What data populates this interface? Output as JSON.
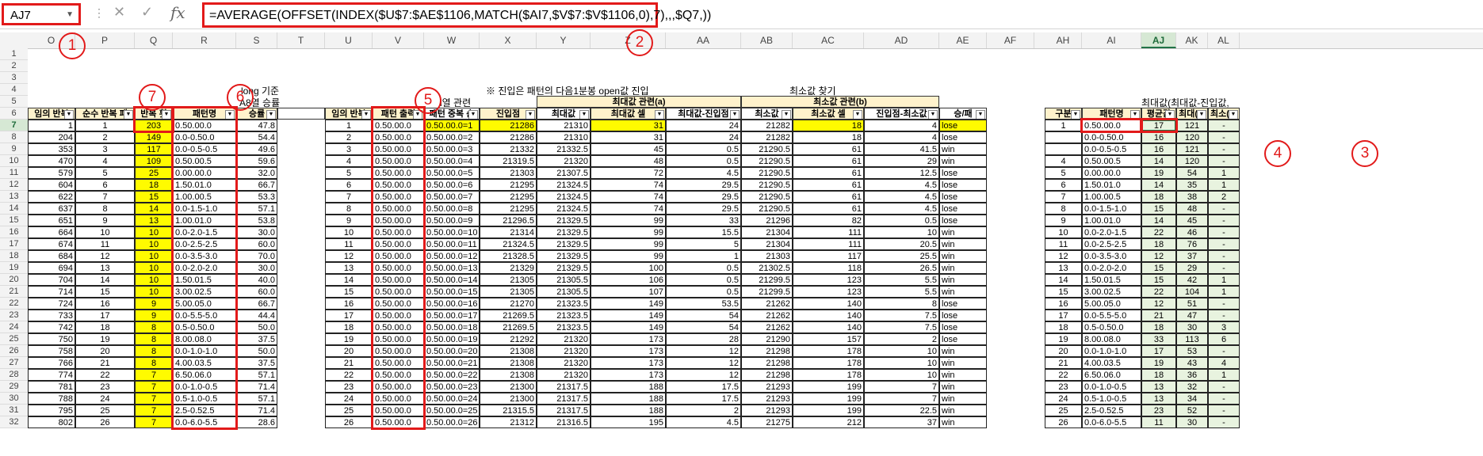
{
  "name_box": "AJ7",
  "formula": "=AVERAGE(OFFSET(INDEX($U$7:$AE$1106,MATCH($AI7,$V$7:$V$1106,0),7),,,$Q7,))",
  "callouts": [
    "1",
    "2",
    "3",
    "4",
    "5",
    "6",
    "7"
  ],
  "columns": [
    "O",
    "P",
    "Q",
    "R",
    "S",
    "T",
    "U",
    "V",
    "W",
    "X",
    "Y",
    "Z",
    "AA",
    "AB",
    "AC",
    "AD",
    "AE",
    "AF",
    "AH",
    "AI",
    "AJ",
    "AK",
    "AL"
  ],
  "row_numbers": [
    1,
    2,
    3,
    4,
    5,
    6,
    7,
    8,
    9,
    10,
    11,
    12,
    13,
    14,
    15,
    16,
    17,
    18,
    19,
    20,
    21,
    22,
    23,
    24,
    25,
    26,
    27,
    28,
    29,
    30,
    31,
    32
  ],
  "top_labels": {
    "long_label1": "long 기준",
    "long_label2": "A8열 승률",
    "note": "※ 진입은 패턴의 다음1분봉 open값 진입",
    "i_col": "i열 관련",
    "min_find": "최소값 찾기",
    "max_group": "최대값 관련(a)",
    "min_group": "최소값 관련(b)",
    "right_group": "최대값(최대값-진입값,"
  },
  "headers": {
    "O": "임의 반복",
    "P": "순수 반복 패",
    "Q": "반복 횟",
    "R": "패턴명",
    "S": "승률",
    "U": "임의 반복",
    "V": "패턴 출력",
    "W": "패턴 중복 순",
    "X": "진입점",
    "Y": "최대값",
    "Z": "최대값 셀",
    "AA": "최대값-진입점",
    "AB": "최소값",
    "AC": "최소값 셀",
    "AD": "진입점-최소값",
    "AE": "승/패",
    "AH": "구분",
    "AI": "패턴명",
    "AJ": "평균값",
    "AK": "최대(c)",
    "AL": "최소(d)"
  },
  "left_rows": [
    [
      "1",
      "1",
      "203",
      "0.50.00.0",
      "47.8"
    ],
    [
      "204",
      "2",
      "149",
      "0.0-0.50.0",
      "54.4"
    ],
    [
      "353",
      "3",
      "117",
      "0.0-0.5-0.5",
      "49.6"
    ],
    [
      "470",
      "4",
      "109",
      "0.50.00.5",
      "59.6"
    ],
    [
      "579",
      "5",
      "25",
      "0.00.00.0",
      "32.0"
    ],
    [
      "604",
      "6",
      "18",
      "1.50.01.0",
      "66.7"
    ],
    [
      "622",
      "7",
      "15",
      "1.00.00.5",
      "53.3"
    ],
    [
      "637",
      "8",
      "14",
      "0.0-1.5-1.0",
      "57.1"
    ],
    [
      "651",
      "9",
      "13",
      "1.00.01.0",
      "53.8"
    ],
    [
      "664",
      "10",
      "10",
      "0.0-2.0-1.5",
      "30.0"
    ],
    [
      "674",
      "11",
      "10",
      "0.0-2.5-2.5",
      "60.0"
    ],
    [
      "684",
      "12",
      "10",
      "0.0-3.5-3.0",
      "70.0"
    ],
    [
      "694",
      "13",
      "10",
      "0.0-2.0-2.0",
      "30.0"
    ],
    [
      "704",
      "14",
      "10",
      "1.50.01.5",
      "40.0"
    ],
    [
      "714",
      "15",
      "10",
      "3.00.02.5",
      "60.0"
    ],
    [
      "724",
      "16",
      "9",
      "5.00.05.0",
      "66.7"
    ],
    [
      "733",
      "17",
      "9",
      "0.0-5.5-5.0",
      "44.4"
    ],
    [
      "742",
      "18",
      "8",
      "0.5-0.50.0",
      "50.0"
    ],
    [
      "750",
      "19",
      "8",
      "8.00.08.0",
      "37.5"
    ],
    [
      "758",
      "20",
      "8",
      "0.0-1.0-1.0",
      "50.0"
    ],
    [
      "766",
      "21",
      "8",
      "4.00.03.5",
      "37.5"
    ],
    [
      "774",
      "22",
      "7",
      "6.50.06.0",
      "57.1"
    ],
    [
      "781",
      "23",
      "7",
      "0.0-1.0-0.5",
      "71.4"
    ],
    [
      "788",
      "24",
      "7",
      "0.5-1.0-0.5",
      "57.1"
    ],
    [
      "795",
      "25",
      "7",
      "2.5-0.52.5",
      "71.4"
    ],
    [
      "802",
      "26",
      "7",
      "0.0-6.0-5.5",
      "28.6"
    ]
  ],
  "mid_rows": [
    [
      "1",
      "0.50.00.0",
      "0.50.00.0=1",
      "21286",
      "21310",
      "31",
      "24",
      "21282",
      "18",
      "4",
      "lose"
    ],
    [
      "2",
      "0.50.00.0",
      "0.50.00.0=2",
      "21286",
      "21310",
      "31",
      "24",
      "21282",
      "18",
      "4",
      "lose"
    ],
    [
      "3",
      "0.50.00.0",
      "0.50.00.0=3",
      "21332",
      "21332.5",
      "45",
      "0.5",
      "21290.5",
      "61",
      "41.5",
      "win"
    ],
    [
      "4",
      "0.50.00.0",
      "0.50.00.0=4",
      "21319.5",
      "21320",
      "48",
      "0.5",
      "21290.5",
      "61",
      "29",
      "win"
    ],
    [
      "5",
      "0.50.00.0",
      "0.50.00.0=5",
      "21303",
      "21307.5",
      "72",
      "4.5",
      "21290.5",
      "61",
      "12.5",
      "lose"
    ],
    [
      "6",
      "0.50.00.0",
      "0.50.00.0=6",
      "21295",
      "21324.5",
      "74",
      "29.5",
      "21290.5",
      "61",
      "4.5",
      "lose"
    ],
    [
      "7",
      "0.50.00.0",
      "0.50.00.0=7",
      "21295",
      "21324.5",
      "74",
      "29.5",
      "21290.5",
      "61",
      "4.5",
      "lose"
    ],
    [
      "8",
      "0.50.00.0",
      "0.50.00.0=8",
      "21295",
      "21324.5",
      "74",
      "29.5",
      "21290.5",
      "61",
      "4.5",
      "lose"
    ],
    [
      "9",
      "0.50.00.0",
      "0.50.00.0=9",
      "21296.5",
      "21329.5",
      "99",
      "33",
      "21296",
      "82",
      "0.5",
      "lose"
    ],
    [
      "10",
      "0.50.00.0",
      "0.50.00.0=10",
      "21314",
      "21329.5",
      "99",
      "15.5",
      "21304",
      "111",
      "10",
      "win"
    ],
    [
      "11",
      "0.50.00.0",
      "0.50.00.0=11",
      "21324.5",
      "21329.5",
      "99",
      "5",
      "21304",
      "111",
      "20.5",
      "win"
    ],
    [
      "12",
      "0.50.00.0",
      "0.50.00.0=12",
      "21328.5",
      "21329.5",
      "99",
      "1",
      "21303",
      "117",
      "25.5",
      "win"
    ],
    [
      "13",
      "0.50.00.0",
      "0.50.00.0=13",
      "21329",
      "21329.5",
      "100",
      "0.5",
      "21302.5",
      "118",
      "26.5",
      "win"
    ],
    [
      "14",
      "0.50.00.0",
      "0.50.00.0=14",
      "21305",
      "21305.5",
      "106",
      "0.5",
      "21299.5",
      "123",
      "5.5",
      "win"
    ],
    [
      "15",
      "0.50.00.0",
      "0.50.00.0=15",
      "21305",
      "21305.5",
      "107",
      "0.5",
      "21299.5",
      "123",
      "5.5",
      "win"
    ],
    [
      "16",
      "0.50.00.0",
      "0.50.00.0=16",
      "21270",
      "21323.5",
      "149",
      "53.5",
      "21262",
      "140",
      "8",
      "lose"
    ],
    [
      "17",
      "0.50.00.0",
      "0.50.00.0=17",
      "21269.5",
      "21323.5",
      "149",
      "54",
      "21262",
      "140",
      "7.5",
      "lose"
    ],
    [
      "18",
      "0.50.00.0",
      "0.50.00.0=18",
      "21269.5",
      "21323.5",
      "149",
      "54",
      "21262",
      "140",
      "7.5",
      "lose"
    ],
    [
      "19",
      "0.50.00.0",
      "0.50.00.0=19",
      "21292",
      "21320",
      "173",
      "28",
      "21290",
      "157",
      "2",
      "lose"
    ],
    [
      "20",
      "0.50.00.0",
      "0.50.00.0=20",
      "21308",
      "21320",
      "173",
      "12",
      "21298",
      "178",
      "10",
      "win"
    ],
    [
      "21",
      "0.50.00.0",
      "0.50.00.0=21",
      "21308",
      "21320",
      "173",
      "12",
      "21298",
      "178",
      "10",
      "win"
    ],
    [
      "22",
      "0.50.00.0",
      "0.50.00.0=22",
      "21308",
      "21320",
      "173",
      "12",
      "21298",
      "178",
      "10",
      "win"
    ],
    [
      "23",
      "0.50.00.0",
      "0.50.00.0=23",
      "21300",
      "21317.5",
      "188",
      "17.5",
      "21293",
      "199",
      "7",
      "win"
    ],
    [
      "24",
      "0.50.00.0",
      "0.50.00.0=24",
      "21300",
      "21317.5",
      "188",
      "17.5",
      "21293",
      "199",
      "7",
      "win"
    ],
    [
      "25",
      "0.50.00.0",
      "0.50.00.0=25",
      "21315.5",
      "21317.5",
      "188",
      "2",
      "21293",
      "199",
      "22.5",
      "win"
    ],
    [
      "26",
      "0.50.00.0",
      "0.50.00.0=26",
      "21312",
      "21316.5",
      "195",
      "4.5",
      "21275",
      "212",
      "37",
      "win"
    ]
  ],
  "right_rows": [
    [
      "1",
      "0.50.00.0",
      "17",
      "121",
      "-"
    ],
    [
      "",
      "0.0-0.50.0",
      "16",
      "120",
      "-"
    ],
    [
      "",
      "0.0-0.5-0.5",
      "16",
      "121",
      "-"
    ],
    [
      "4",
      "0.50.00.5",
      "14",
      "120",
      "-"
    ],
    [
      "5",
      "0.00.00.0",
      "19",
      "54",
      "1"
    ],
    [
      "6",
      "1.50.01.0",
      "14",
      "35",
      "1"
    ],
    [
      "7",
      "1.00.00.5",
      "18",
      "38",
      "2"
    ],
    [
      "8",
      "0.0-1.5-1.0",
      "15",
      "48",
      "-"
    ],
    [
      "9",
      "1.00.01.0",
      "14",
      "45",
      "-"
    ],
    [
      "10",
      "0.0-2.0-1.5",
      "22",
      "46",
      "-"
    ],
    [
      "11",
      "0.0-2.5-2.5",
      "18",
      "76",
      "-"
    ],
    [
      "12",
      "0.0-3.5-3.0",
      "12",
      "37",
      "-"
    ],
    [
      "13",
      "0.0-2.0-2.0",
      "15",
      "29",
      "-"
    ],
    [
      "14",
      "1.50.01.5",
      "15",
      "42",
      "1"
    ],
    [
      "15",
      "3.00.02.5",
      "22",
      "104",
      "1"
    ],
    [
      "16",
      "5.00.05.0",
      "12",
      "51",
      "-"
    ],
    [
      "17",
      "0.0-5.5-5.0",
      "21",
      "47",
      "-"
    ],
    [
      "18",
      "0.5-0.50.0",
      "18",
      "30",
      "3"
    ],
    [
      "19",
      "8.00.08.0",
      "33",
      "113",
      "6"
    ],
    [
      "20",
      "0.0-1.0-1.0",
      "17",
      "53",
      "-"
    ],
    [
      "21",
      "4.00.03.5",
      "19",
      "43",
      "4"
    ],
    [
      "22",
      "6.50.06.0",
      "18",
      "36",
      "1"
    ],
    [
      "23",
      "0.0-1.0-0.5",
      "13",
      "32",
      "-"
    ],
    [
      "24",
      "0.5-1.0-0.5",
      "13",
      "34",
      "-"
    ],
    [
      "25",
      "2.5-0.52.5",
      "23",
      "52",
      "-"
    ],
    [
      "26",
      "0.0-6.0-5.5",
      "11",
      "30",
      "-"
    ]
  ],
  "colors": {
    "accent_red": "#e21a1a",
    "yellow": "#fffb00",
    "header_fill": "#fff2cc",
    "excel_green": "#217346"
  }
}
